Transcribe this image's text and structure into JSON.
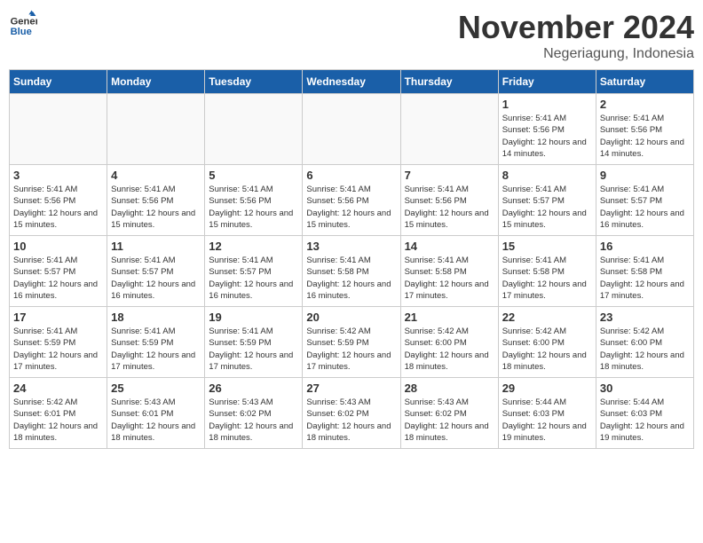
{
  "header": {
    "logo_line1": "General",
    "logo_line2": "Blue",
    "month": "November 2024",
    "location": "Negeriagung, Indonesia"
  },
  "days_of_week": [
    "Sunday",
    "Monday",
    "Tuesday",
    "Wednesday",
    "Thursday",
    "Friday",
    "Saturday"
  ],
  "weeks": [
    [
      {
        "day": "",
        "info": ""
      },
      {
        "day": "",
        "info": ""
      },
      {
        "day": "",
        "info": ""
      },
      {
        "day": "",
        "info": ""
      },
      {
        "day": "",
        "info": ""
      },
      {
        "day": "1",
        "info": "Sunrise: 5:41 AM\nSunset: 5:56 PM\nDaylight: 12 hours\nand 14 minutes."
      },
      {
        "day": "2",
        "info": "Sunrise: 5:41 AM\nSunset: 5:56 PM\nDaylight: 12 hours\nand 14 minutes."
      }
    ],
    [
      {
        "day": "3",
        "info": "Sunrise: 5:41 AM\nSunset: 5:56 PM\nDaylight: 12 hours\nand 15 minutes."
      },
      {
        "day": "4",
        "info": "Sunrise: 5:41 AM\nSunset: 5:56 PM\nDaylight: 12 hours\nand 15 minutes."
      },
      {
        "day": "5",
        "info": "Sunrise: 5:41 AM\nSunset: 5:56 PM\nDaylight: 12 hours\nand 15 minutes."
      },
      {
        "day": "6",
        "info": "Sunrise: 5:41 AM\nSunset: 5:56 PM\nDaylight: 12 hours\nand 15 minutes."
      },
      {
        "day": "7",
        "info": "Sunrise: 5:41 AM\nSunset: 5:56 PM\nDaylight: 12 hours\nand 15 minutes."
      },
      {
        "day": "8",
        "info": "Sunrise: 5:41 AM\nSunset: 5:57 PM\nDaylight: 12 hours\nand 15 minutes."
      },
      {
        "day": "9",
        "info": "Sunrise: 5:41 AM\nSunset: 5:57 PM\nDaylight: 12 hours\nand 16 minutes."
      }
    ],
    [
      {
        "day": "10",
        "info": "Sunrise: 5:41 AM\nSunset: 5:57 PM\nDaylight: 12 hours\nand 16 minutes."
      },
      {
        "day": "11",
        "info": "Sunrise: 5:41 AM\nSunset: 5:57 PM\nDaylight: 12 hours\nand 16 minutes."
      },
      {
        "day": "12",
        "info": "Sunrise: 5:41 AM\nSunset: 5:57 PM\nDaylight: 12 hours\nand 16 minutes."
      },
      {
        "day": "13",
        "info": "Sunrise: 5:41 AM\nSunset: 5:58 PM\nDaylight: 12 hours\nand 16 minutes."
      },
      {
        "day": "14",
        "info": "Sunrise: 5:41 AM\nSunset: 5:58 PM\nDaylight: 12 hours\nand 17 minutes."
      },
      {
        "day": "15",
        "info": "Sunrise: 5:41 AM\nSunset: 5:58 PM\nDaylight: 12 hours\nand 17 minutes."
      },
      {
        "day": "16",
        "info": "Sunrise: 5:41 AM\nSunset: 5:58 PM\nDaylight: 12 hours\nand 17 minutes."
      }
    ],
    [
      {
        "day": "17",
        "info": "Sunrise: 5:41 AM\nSunset: 5:59 PM\nDaylight: 12 hours\nand 17 minutes."
      },
      {
        "day": "18",
        "info": "Sunrise: 5:41 AM\nSunset: 5:59 PM\nDaylight: 12 hours\nand 17 minutes."
      },
      {
        "day": "19",
        "info": "Sunrise: 5:41 AM\nSunset: 5:59 PM\nDaylight: 12 hours\nand 17 minutes."
      },
      {
        "day": "20",
        "info": "Sunrise: 5:42 AM\nSunset: 5:59 PM\nDaylight: 12 hours\nand 17 minutes."
      },
      {
        "day": "21",
        "info": "Sunrise: 5:42 AM\nSunset: 6:00 PM\nDaylight: 12 hours\nand 18 minutes."
      },
      {
        "day": "22",
        "info": "Sunrise: 5:42 AM\nSunset: 6:00 PM\nDaylight: 12 hours\nand 18 minutes."
      },
      {
        "day": "23",
        "info": "Sunrise: 5:42 AM\nSunset: 6:00 PM\nDaylight: 12 hours\nand 18 minutes."
      }
    ],
    [
      {
        "day": "24",
        "info": "Sunrise: 5:42 AM\nSunset: 6:01 PM\nDaylight: 12 hours\nand 18 minutes."
      },
      {
        "day": "25",
        "info": "Sunrise: 5:43 AM\nSunset: 6:01 PM\nDaylight: 12 hours\nand 18 minutes."
      },
      {
        "day": "26",
        "info": "Sunrise: 5:43 AM\nSunset: 6:02 PM\nDaylight: 12 hours\nand 18 minutes."
      },
      {
        "day": "27",
        "info": "Sunrise: 5:43 AM\nSunset: 6:02 PM\nDaylight: 12 hours\nand 18 minutes."
      },
      {
        "day": "28",
        "info": "Sunrise: 5:43 AM\nSunset: 6:02 PM\nDaylight: 12 hours\nand 18 minutes."
      },
      {
        "day": "29",
        "info": "Sunrise: 5:44 AM\nSunset: 6:03 PM\nDaylight: 12 hours\nand 19 minutes."
      },
      {
        "day": "30",
        "info": "Sunrise: 5:44 AM\nSunset: 6:03 PM\nDaylight: 12 hours\nand 19 minutes."
      }
    ]
  ]
}
